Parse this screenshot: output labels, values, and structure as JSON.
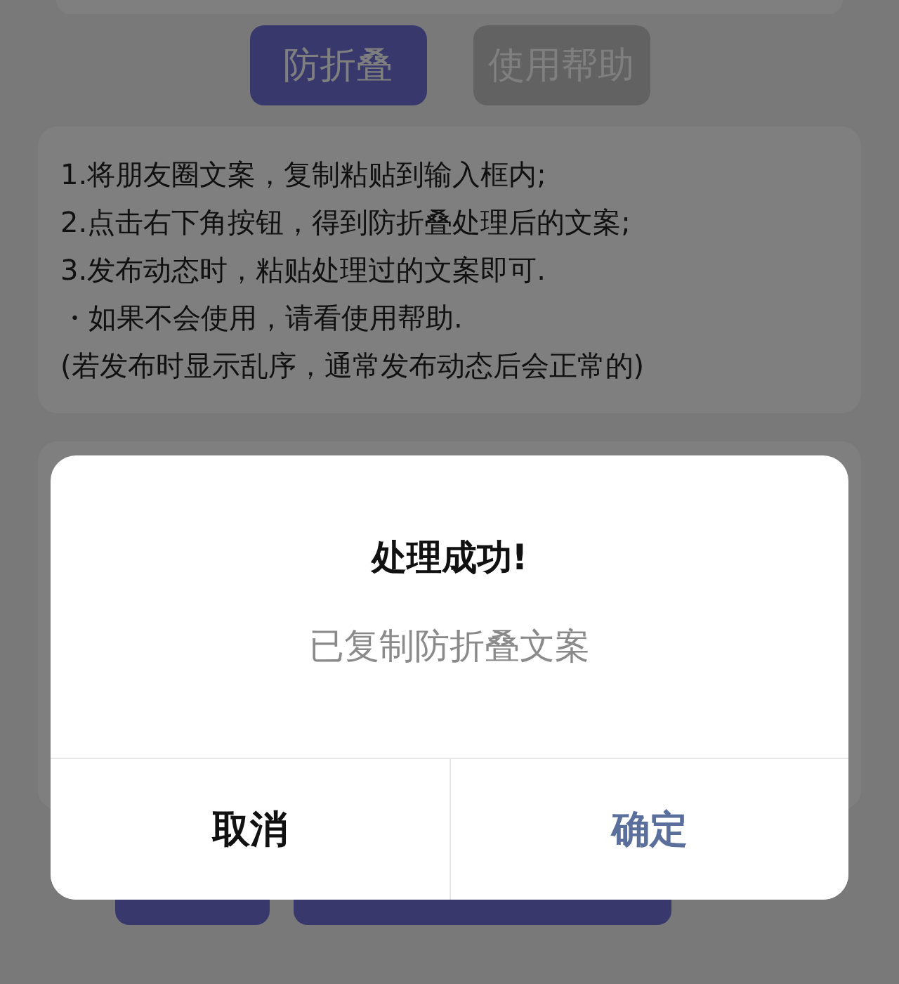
{
  "mode_tabs": [
    {
      "label": "防折叠",
      "selected": true
    },
    {
      "label": "使用帮助",
      "selected": false
    }
  ],
  "instructions": [
    "1.将朋友圈文案，复制粘贴到输入框内;",
    "2.点击右下角按钮，得到防折叠处理后的文案;",
    "3.发布动态时，粘贴处理过的文案即可.",
    "・如果不会使用，请看使用帮助.",
    "(若发布时显示乱序，通常发布动态后会正常的)"
  ],
  "bottom_buttons": [
    {
      "kind": "narrow"
    },
    {
      "kind": "wide"
    }
  ],
  "dialog": {
    "title": "处理成功!",
    "message": "已复制防折叠文案",
    "buttons": [
      {
        "label": "取消",
        "kind": "cancel"
      },
      {
        "label": "确定",
        "kind": "confirm"
      }
    ]
  }
}
